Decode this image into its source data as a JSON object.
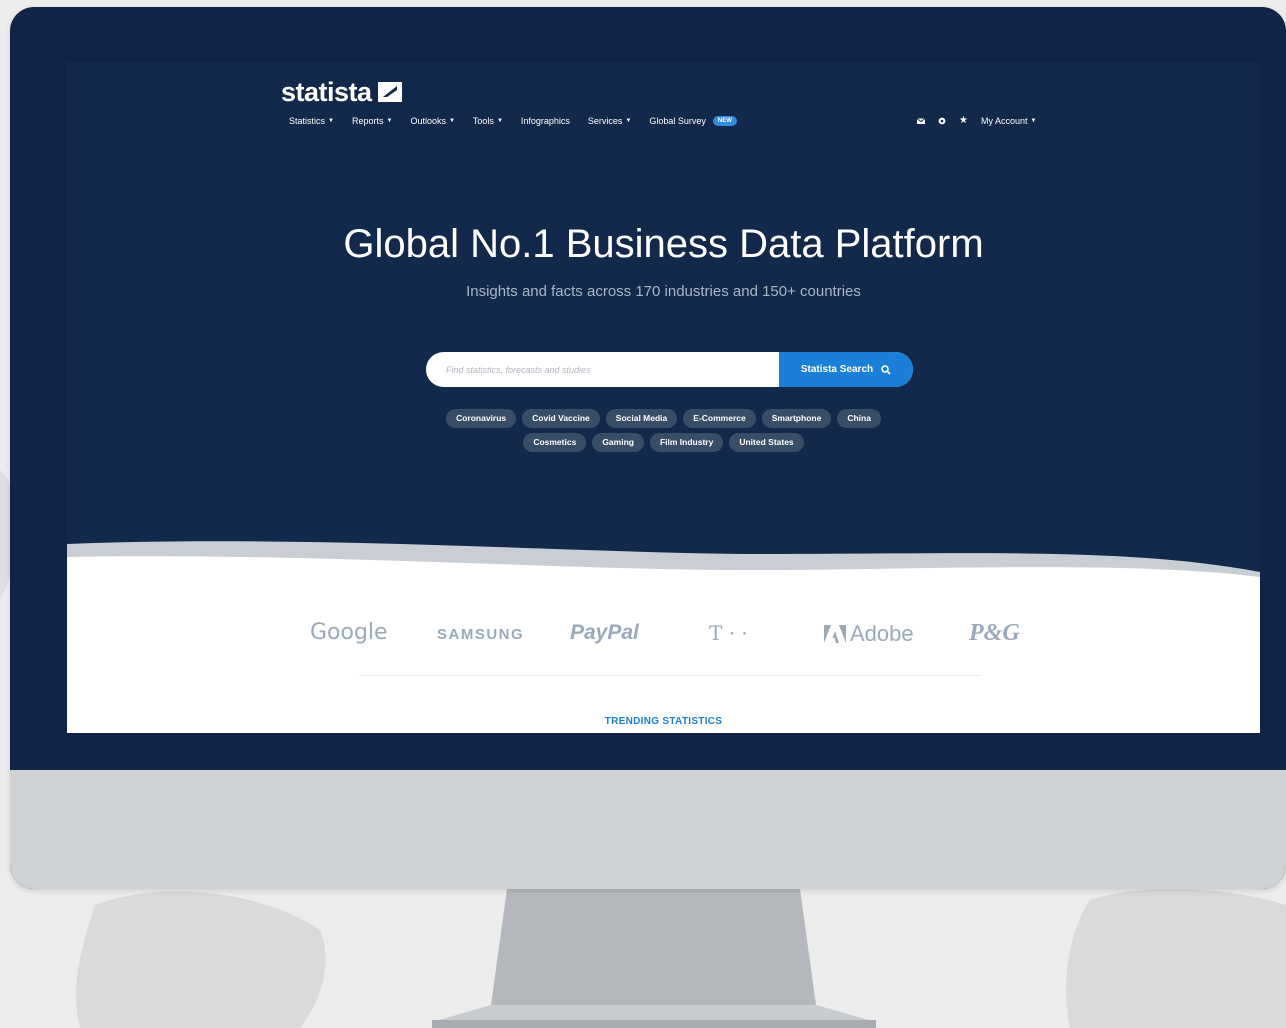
{
  "site": {
    "logo_text": "statista",
    "nav": [
      {
        "label": "Statistics",
        "caret": true
      },
      {
        "label": "Reports",
        "caret": true
      },
      {
        "label": "Outlooks",
        "caret": true
      },
      {
        "label": "Tools",
        "caret": true
      },
      {
        "label": "Infographics",
        "caret": false
      },
      {
        "label": "Services",
        "caret": true
      },
      {
        "label": "Global Survey",
        "caret": false,
        "badge": "NEW"
      }
    ],
    "nav_right": {
      "icons": [
        "mail-icon",
        "gear-icon",
        "star-icon"
      ],
      "account_label": "My Account"
    }
  },
  "hero": {
    "title": "Global No.1 Business Data Platform",
    "subtitle": "Insights and facts across 170 industries and 150+ countries",
    "search": {
      "placeholder": "Find statistics, forecasts and studies",
      "button_label": "Statista Search",
      "button_icon": "search-icon"
    },
    "tags_row1": [
      "Coronavirus",
      "Covid Vaccine",
      "Social Media",
      "E-Commerce",
      "Smartphone",
      "China"
    ],
    "tags_row2": [
      "Cosmetics",
      "Gaming",
      "Film Industry",
      "United States"
    ]
  },
  "brands": {
    "google": "Google",
    "samsung": "SAMSUNG",
    "paypal": "PayPal",
    "telekom": "T · ·",
    "adobe": "Adobe",
    "pg": "P&G"
  },
  "trending_label": "TRENDING STATISTICS",
  "colors": {
    "hero_bg": "#13294b",
    "accent": "#1a7fd6",
    "tag_bg": "#3a4d67",
    "bezel": "#0f2446",
    "chin": "#cfd2d5"
  }
}
